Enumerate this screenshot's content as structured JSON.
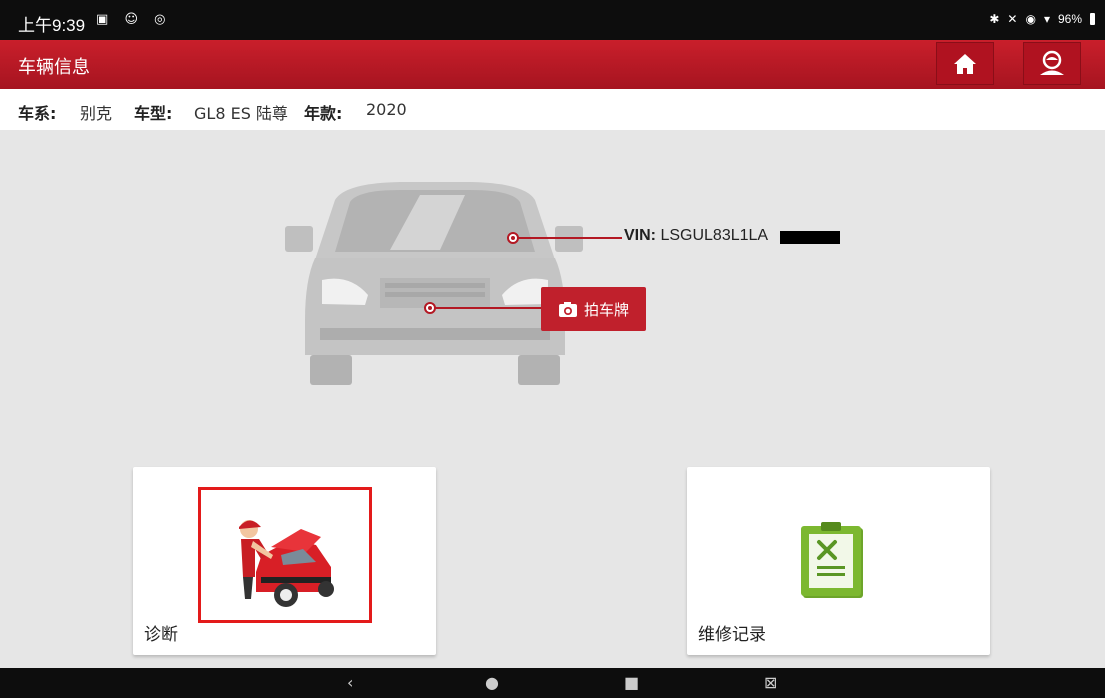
{
  "status_bar": {
    "time": "上午9:39",
    "left_icons": [
      "gallery-icon",
      "accessibility-icon",
      "message-icon"
    ],
    "right_icons": [
      "bluetooth-icon",
      "mute-icon",
      "location-icon",
      "wifi-icon"
    ],
    "battery": "96%"
  },
  "header": {
    "title": "车辆信息",
    "home_icon": "home-icon",
    "user_icon": "user-icon"
  },
  "vehicle_info": {
    "series_label": "车系:",
    "series_value": "别克",
    "model_label": "车型:",
    "model_value": "GL8 ES 陆尊",
    "year_label": "年款:",
    "year_value": "2020"
  },
  "vin": {
    "label": "VIN:",
    "value": "LSGUL83L1LA"
  },
  "plate_button": {
    "label": "拍车牌",
    "icon": "camera-icon"
  },
  "cards": {
    "diagnosis": {
      "label": "诊断",
      "icon": "mechanic-car-icon"
    },
    "records": {
      "label": "维修记录",
      "icon": "clipboard-tools-icon"
    }
  },
  "colors": {
    "brand_red": "#c0202c",
    "highlight_red": "#e31a1a",
    "records_green": "#7cb830"
  },
  "nav": [
    "back-icon",
    "home-circle-icon",
    "recents-icon",
    "screenshot-icon"
  ]
}
